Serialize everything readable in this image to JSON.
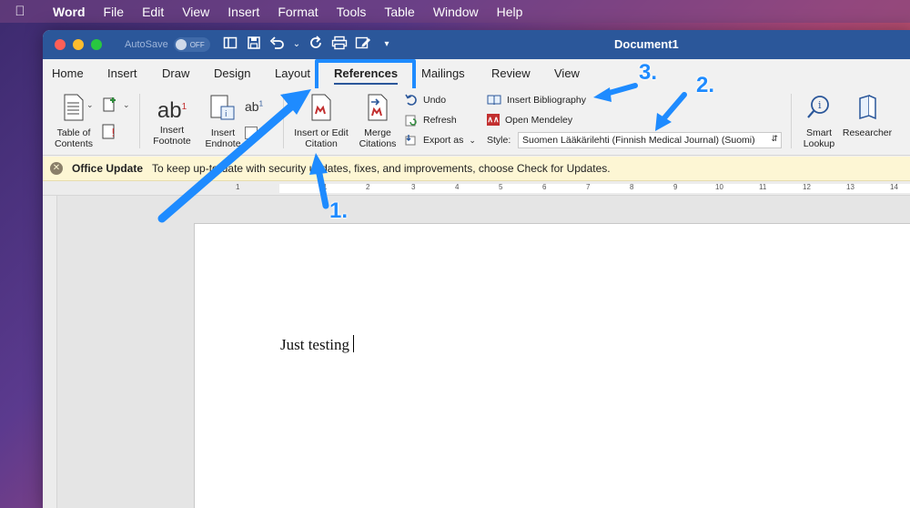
{
  "menubar": {
    "app": "Word",
    "items": [
      "File",
      "Edit",
      "View",
      "Insert",
      "Format",
      "Tools",
      "Table",
      "Window",
      "Help"
    ]
  },
  "titlebar": {
    "autosave_label": "AutoSave",
    "autosave_state": "OFF",
    "document_title": "Document1"
  },
  "tabs": [
    "Home",
    "Insert",
    "Draw",
    "Design",
    "Layout",
    "References",
    "Mailings",
    "Review",
    "View"
  ],
  "active_tab": "References",
  "ribbon": {
    "toc_label": "Table of Contents",
    "insert_footnote": "Insert Footnote",
    "insert_endnote": "Insert Endnote",
    "insert_citation": "Insert or Edit Citation",
    "merge_citations": "Merge Citations",
    "undo": "Undo",
    "refresh": "Refresh",
    "export_as": "Export as",
    "insert_bibliography": "Insert Bibliography",
    "open_mendeley": "Open Mendeley",
    "style_label": "Style:",
    "style_value": "Suomen Lääkärilehti (Finnish Medical Journal) (Suomi)",
    "smart_lookup": "Smart Lookup",
    "researcher": "Researcher"
  },
  "update_bar": {
    "title": "Office Update",
    "message": "To keep up-to-date with security updates, fixes, and improvements, choose Check for Updates."
  },
  "ruler": {
    "numbers": [
      "1",
      "1",
      "2",
      "3",
      "4",
      "5",
      "6",
      "7",
      "8",
      "9",
      "10",
      "11",
      "12",
      "13",
      "14"
    ]
  },
  "document": {
    "text": "Just testing"
  },
  "annotations": {
    "label_1": "1.",
    "label_2": "2.",
    "label_3": "3.",
    "color": "#1e8bff"
  },
  "colors": {
    "word_blue": "#2b579a",
    "update_bar": "#fdf6d4",
    "mendeley_red": "#c22f2f"
  }
}
